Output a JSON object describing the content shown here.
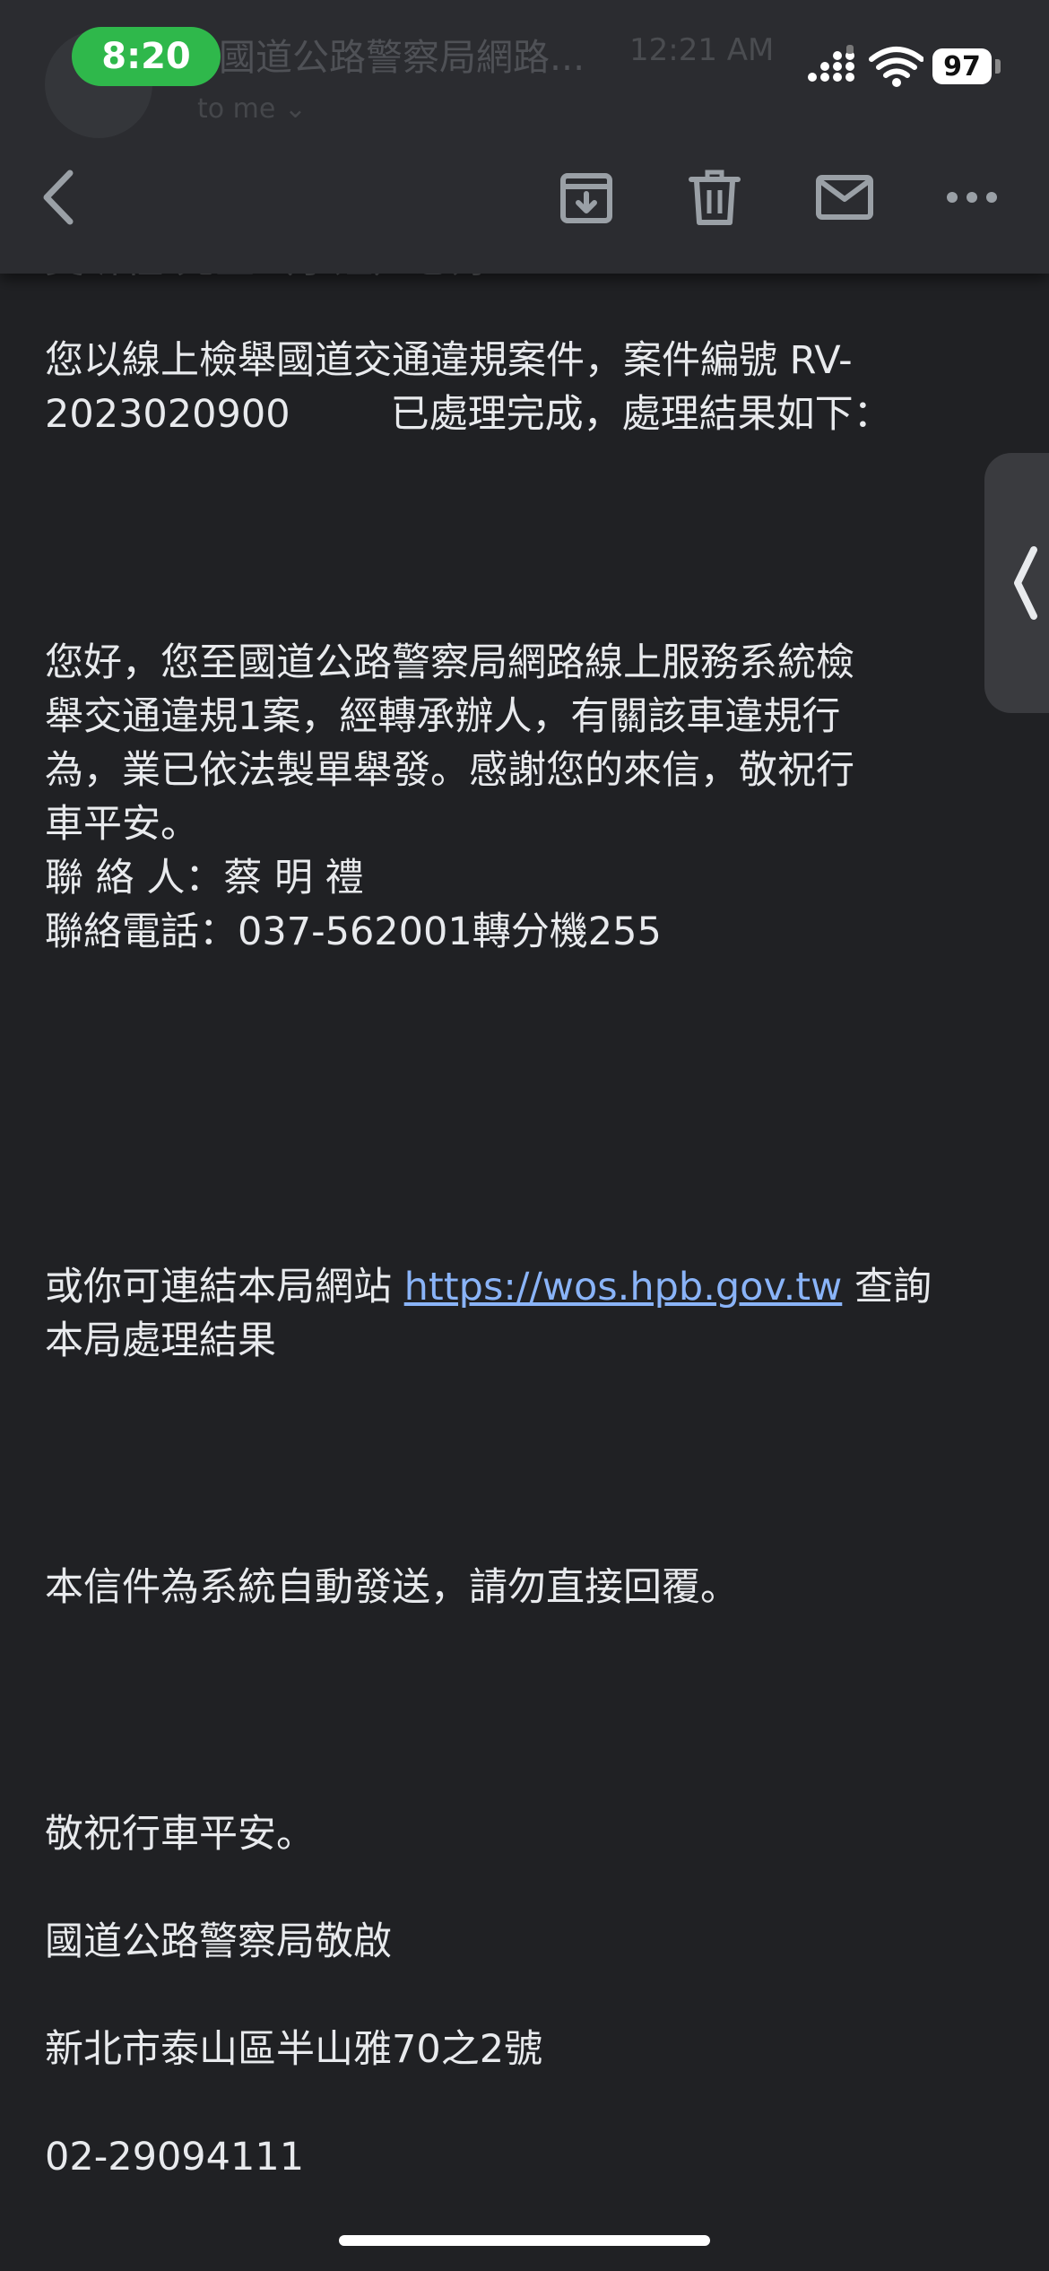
{
  "status_bar": {
    "time": "8:20",
    "battery": "97"
  },
  "header": {
    "ghost_subject": "國道公路警察局網路...",
    "ghost_time": "12:21 AM",
    "ghost_recipient": "to me ⌄",
    "ghost_greeting": "吳昕程 先生（小姐）您好："
  },
  "toolbar": {
    "icons": [
      "back-icon",
      "archive-icon",
      "trash-icon",
      "mail-icon",
      "more-icon"
    ]
  },
  "email": {
    "line1": "您以線上檢舉國道交通違規案件，案件編號 RV-",
    "line2a": "2023020900",
    "line2b": "已處理完成，處理結果如下：",
    "reply": [
      "您好，您至國道公路警察局網路線上服務系統檢",
      "舉交通違規1案，經轉承辦人，有關該車違規行",
      "為，業已依法製單舉發。感謝您的來信，敬祝行",
      "車平安。"
    ],
    "contact_person": "聯 絡 人：蔡 明 禮",
    "contact_phone": "聯絡電話：037-562001轉分機255",
    "link_prefix": "或你可連結本局網站 ",
    "link_url": "https://wos.hpb.gov.tw",
    "link_suffix": " 查詢",
    "link_line2": "本局處理結果",
    "auto_notice": "本信件為系統自動發送，請勿直接回覆。",
    "closing": "敬祝行車平安。",
    "signature": "國道公路警察局敬啟",
    "address": "新北市泰山區半山雅70之2號",
    "phone": "02-29094111"
  },
  "colors": {
    "background": "#202124",
    "header": "#2b2c30",
    "text": "#e8eaed",
    "link": "#8ab4f8",
    "time_pill": "#2fb84b"
  }
}
